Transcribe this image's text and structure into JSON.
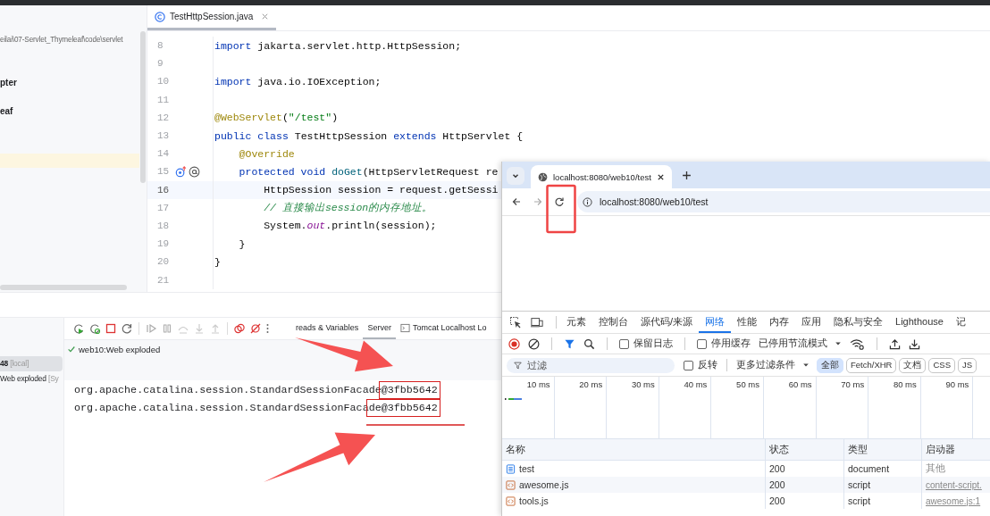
{
  "ide": {
    "project_tree": {
      "path": "eilai\\07-Servlet_Thymeleaf\\code\\servlet",
      "items": [
        {
          "label": "pter"
        },
        {
          "label": "eaf"
        }
      ]
    },
    "editor": {
      "tab": {
        "label": "TestHttpSession.java",
        "selected": true
      },
      "lines": [
        {
          "number": "8",
          "current": false,
          "tokens": [
            {
              "text": "import",
              "kind": "keyword"
            },
            {
              "text": " jakarta.servlet.http.HttpSession;",
              "kind": "plain"
            }
          ]
        },
        {
          "number": "9",
          "current": false
        },
        {
          "number": "10",
          "current": false,
          "tokens": [
            {
              "text": "import",
              "kind": "keyword"
            },
            {
              "text": " java.io.IOException;",
              "kind": "plain"
            }
          ]
        },
        {
          "number": "11",
          "current": false
        },
        {
          "number": "12",
          "current": false,
          "tokens": [
            {
              "text": "@WebServlet",
              "kind": "annotation"
            },
            {
              "text": "(",
              "kind": "plain"
            },
            {
              "text": "\"/test\"",
              "kind": "string"
            },
            {
              "text": ")",
              "kind": "plain"
            }
          ]
        },
        {
          "number": "13",
          "current": false,
          "tokens": [
            {
              "text": "public class",
              "kind": "keyword"
            },
            {
              "text": " TestHttpSession ",
              "kind": "plain"
            },
            {
              "text": "extends",
              "kind": "keyword"
            },
            {
              "text": " HttpServlet {",
              "kind": "plain"
            }
          ]
        },
        {
          "number": "14",
          "current": false,
          "tokens": [
            {
              "text": "    @Override",
              "kind": "annotation"
            }
          ]
        },
        {
          "number": "15",
          "current": false,
          "overrides": true,
          "tokens": [
            {
              "text": "    protected void ",
              "kind": "keyword"
            },
            {
              "text": "doGet",
              "kind": "method"
            },
            {
              "text": "(HttpServletRequest re",
              "kind": "plain"
            }
          ]
        },
        {
          "number": "16",
          "current": true,
          "tokens": [
            {
              "text": "        HttpSession session = request.getSessi",
              "kind": "plain"
            }
          ]
        },
        {
          "number": "17",
          "current": false,
          "tokens": [
            {
              "text": "        // 直接输出session的内存地址。",
              "kind": "comment"
            }
          ]
        },
        {
          "number": "18",
          "current": false,
          "tokens": [
            {
              "text": "        System.",
              "kind": "plain"
            },
            {
              "text": "out",
              "kind": "field"
            },
            {
              "text": ".println(session);",
              "kind": "plain"
            }
          ]
        },
        {
          "number": "19",
          "current": false,
          "tokens": [
            {
              "text": "    }",
              "kind": "plain"
            }
          ]
        },
        {
          "number": "20",
          "current": false,
          "tokens": [
            {
              "text": "}",
              "kind": "plain"
            }
          ]
        },
        {
          "number": "21",
          "current": false
        }
      ]
    },
    "run_panel": {
      "sessions": [
        {
          "label": "48",
          "suffix": "[local]",
          "selected": true
        },
        {
          "label": "Web exploded",
          "suffix": "[Sy",
          "selected": false
        }
      ],
      "tabs": [
        {
          "label": "reads & Variables",
          "selected": false,
          "kind": "plain"
        },
        {
          "label": "Server",
          "selected": true,
          "kind": "plain"
        },
        {
          "label": "Tomcat Localhost Lo",
          "selected": false,
          "kind": "log"
        }
      ],
      "deployment": {
        "label": "web10:Web exploded",
        "deployed": true
      },
      "output": [
        {
          "text": "org.apache.catalina.session.StandardSessionFacade",
          "framed": "@3fbb5642"
        },
        {
          "text": "org.apache.catalina.session.StandardSessionFaca",
          "framed": "de@3fbb5642"
        }
      ]
    }
  },
  "browser": {
    "tab": {
      "title": "localhost:8080/web10/test"
    },
    "address": "localhost:8080/web10/test",
    "devtools": {
      "panels": [
        {
          "label": "元素",
          "selected": false
        },
        {
          "label": "控制台",
          "selected": false
        },
        {
          "label": "源代码/来源",
          "selected": false
        },
        {
          "label": "网络",
          "selected": true
        },
        {
          "label": "性能",
          "selected": false
        },
        {
          "label": "内存",
          "selected": false
        },
        {
          "label": "应用",
          "selected": false
        },
        {
          "label": "隐私与安全",
          "selected": false
        },
        {
          "label": "Lighthouse",
          "selected": false
        },
        {
          "label": "记",
          "selected": false
        }
      ],
      "recording": true,
      "preserve_log": {
        "label": "保留日志",
        "checked": false
      },
      "disable_cache": {
        "label": "停用缓存",
        "checked": false
      },
      "throttling": "已停用节流模式",
      "filter": {
        "placeholder": "过滤"
      },
      "invert": {
        "label": "反转",
        "checked": false
      },
      "more_filters": "更多过滤条件",
      "type_filters": [
        {
          "label": "全部",
          "selected": true
        },
        {
          "label": "Fetch/XHR",
          "selected": false
        },
        {
          "label": "文档",
          "selected": false
        },
        {
          "label": "CSS",
          "selected": false
        },
        {
          "label": "JS",
          "selected": false
        }
      ],
      "timeline_ticks": [
        "10 ms",
        "20 ms",
        "30 ms",
        "40 ms",
        "50 ms",
        "60 ms",
        "70 ms",
        "80 ms",
        "90 ms"
      ],
      "columns": [
        "名称",
        "状态",
        "类型",
        "启动器"
      ],
      "requests": [
        {
          "name": "test",
          "kind": "document",
          "status": "200",
          "type": "document",
          "initiator": "其他"
        },
        {
          "name": "awesome.js",
          "kind": "script",
          "status": "200",
          "type": "script",
          "initiator": "content-script."
        },
        {
          "name": "tools.js",
          "kind": "script",
          "status": "200",
          "type": "script",
          "initiator": "awesome.js:1"
        }
      ]
    }
  }
}
